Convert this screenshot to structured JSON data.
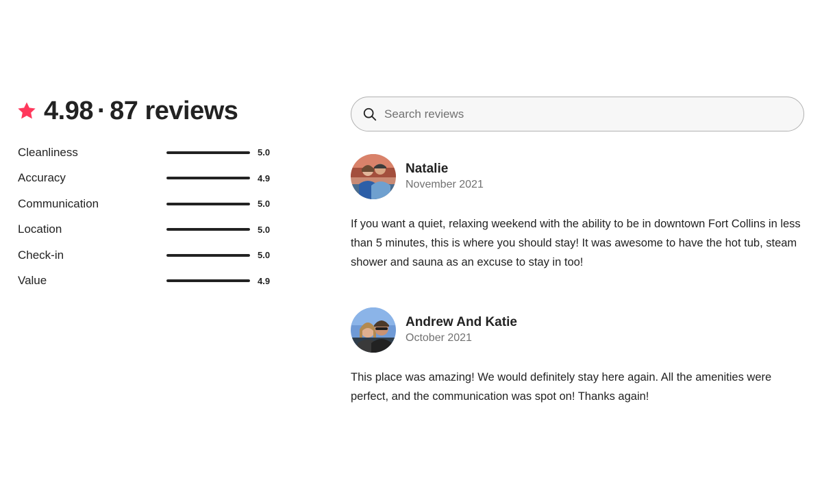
{
  "summary": {
    "rating": "4.98",
    "separator": "·",
    "reviews": "87 reviews",
    "star_icon": "star-icon",
    "accent_color": "#ff385c"
  },
  "categories": [
    {
      "label": "Cleanliness",
      "score": "5.0",
      "fill": 1.0
    },
    {
      "label": "Accuracy",
      "score": "4.9",
      "fill": 1.0
    },
    {
      "label": "Communication",
      "score": "5.0",
      "fill": 1.0
    },
    {
      "label": "Location",
      "score": "5.0",
      "fill": 1.0
    },
    {
      "label": "Check-in",
      "score": "5.0",
      "fill": 1.0
    },
    {
      "label": "Value",
      "score": "4.9",
      "fill": 1.0
    }
  ],
  "search": {
    "placeholder": "Search reviews",
    "value": "",
    "icon": "search-icon"
  },
  "reviews": [
    {
      "name": "Natalie",
      "date": "November 2021",
      "text": "If you want a quiet, relaxing weekend with the ability to be in downtown Fort Collins in less than 5 minutes, this is where you should stay! It was awesome to have the hot tub, steam shower and sauna as an excuse to stay in too!"
    },
    {
      "name": "Andrew And Katie",
      "date": "October 2021",
      "text": "This place was amazing! We would definitely stay here again. All the amenities were perfect, and the communication was spot on! Thanks again!"
    }
  ],
  "colors": {
    "text": "#222222",
    "muted": "#717171",
    "bar_track": "#dddddd",
    "bar_fill": "#222222",
    "search_bg": "#f7f7f7",
    "search_border": "#b0b0b0"
  }
}
